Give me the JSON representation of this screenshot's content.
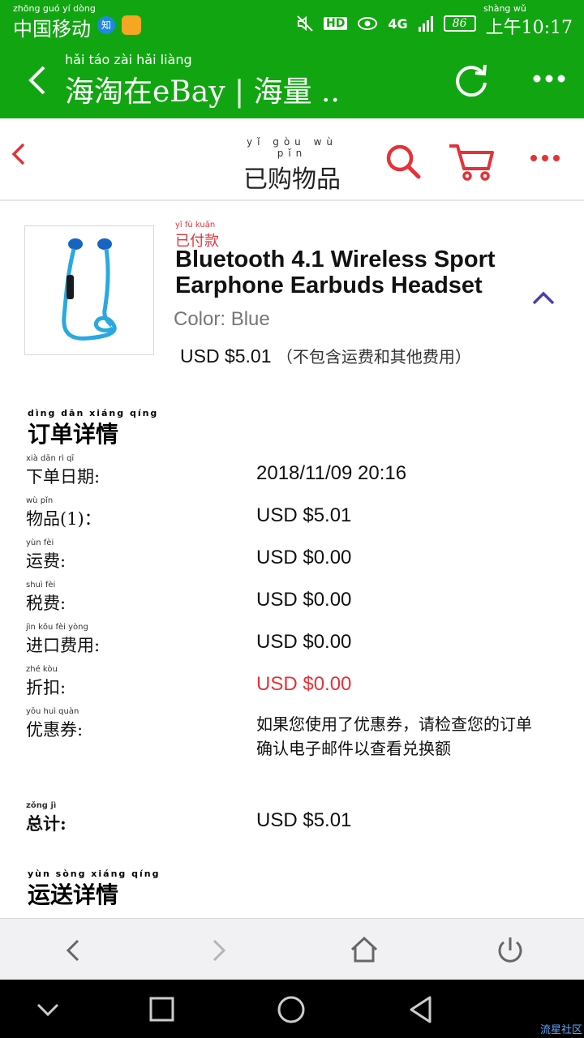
{
  "status_bar": {
    "carrier": "中国移动",
    "carrier_pinyin": "zhōng guó  yí dòng",
    "zhi_badge": "知",
    "hd_label": "HD",
    "network": "4G",
    "battery": "86",
    "time": "上午10:17",
    "time_pinyin": "shàng wǔ"
  },
  "app_header": {
    "title": "海淘在eBay | 海量 ..",
    "title_pinyin": "hǎi  táo  zài               hǎi  liàng"
  },
  "ebay_header": {
    "title": "已购物品",
    "title_pinyin": "yǐ gòu wù pǐn"
  },
  "product": {
    "status_pinyin": "yǐ  fù  kuǎn",
    "status": "已付款",
    "title": "Bluetooth 4.1 Wireless Sport Earphone Earbuds Headset",
    "color": "Color: Blue",
    "price": "USD $5.01",
    "price_note": "（不包含运费和其他费用）"
  },
  "order_details": {
    "title": "订单详情",
    "title_pinyin": "dìng dān xiáng qíng",
    "rows": [
      {
        "label": "下单日期:",
        "pinyin": "xià dān  rì  qī",
        "value": "2018/11/09 20:16"
      },
      {
        "label": "物品(1)：",
        "pinyin": "wù pǐn",
        "value": "USD $5.01"
      },
      {
        "label": "运费:",
        "pinyin": "yùn fèi",
        "value": "USD $0.00"
      },
      {
        "label": "税费:",
        "pinyin": "shuì fèi",
        "value": "USD $0.00"
      },
      {
        "label": "进口费用:",
        "pinyin": "jìn kǒu fèi yòng",
        "value": "USD $0.00"
      },
      {
        "label": "折扣:",
        "pinyin": "zhé kòu",
        "value": "USD $0.00"
      },
      {
        "label": "优惠券:",
        "pinyin": "yōu huì quàn",
        "value": "如果您使用了优惠券，请检查您的订单确认电子邮件以查看兑换额"
      },
      {
        "label": "总计:",
        "pinyin": "zǒng jì",
        "value": "USD $5.01"
      }
    ]
  },
  "shipping_details": {
    "title": "运送详情",
    "title_pinyin": "yùn sòng xiáng qíng"
  },
  "colors": {
    "app_green": "#11a611",
    "ebay_red": "#e53238",
    "collapse_purple": "#4a3fb0"
  },
  "watermark": "流星社区"
}
